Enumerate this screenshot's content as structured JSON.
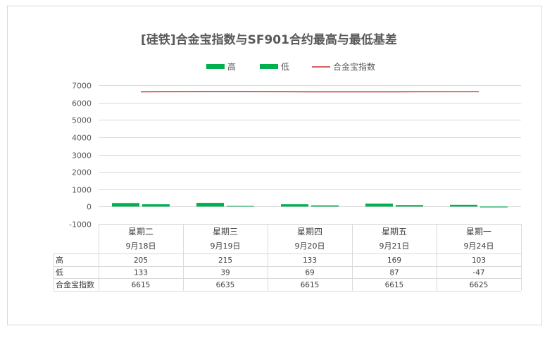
{
  "chart_data": {
    "type": "bar",
    "title": "[硅铁]合金宝指数与SF901合约最高与最低基差",
    "categories": [
      {
        "weekday": "星期二",
        "date": "9月18日"
      },
      {
        "weekday": "星期三",
        "date": "9月19日"
      },
      {
        "weekday": "星期四",
        "date": "9月20日"
      },
      {
        "weekday": "星期五",
        "date": "9月21日"
      },
      {
        "weekday": "星期一",
        "date": "9月24日"
      }
    ],
    "series": [
      {
        "name": "高",
        "kind": "bar",
        "color": "#00b050",
        "values": [
          205,
          215,
          133,
          169,
          103
        ]
      },
      {
        "name": "低",
        "kind": "bar",
        "color": "#00b050",
        "values": [
          133,
          39,
          69,
          87,
          -47
        ]
      },
      {
        "name": "合金宝指数",
        "kind": "line",
        "color": "#c00000",
        "values": [
          6615,
          6635,
          6615,
          6615,
          6625
        ]
      }
    ],
    "ylim": [
      -1000,
      7000
    ],
    "yticks": [
      7000,
      6000,
      5000,
      4000,
      3000,
      2000,
      1000,
      0,
      -1000
    ],
    "grid": true,
    "legend": "top",
    "data_table": true
  }
}
